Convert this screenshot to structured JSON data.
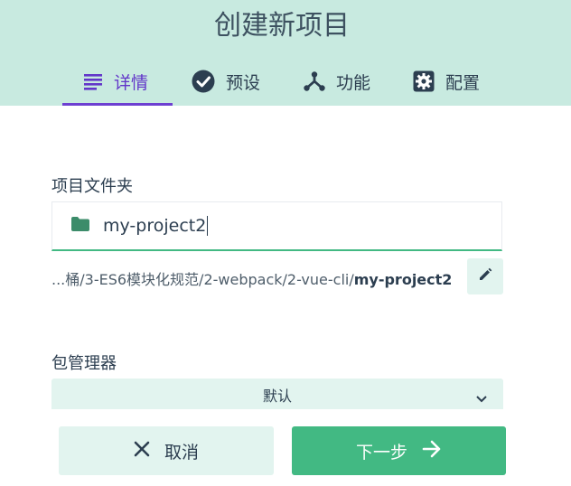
{
  "window": {
    "title": "创建新项目"
  },
  "tabs": [
    {
      "label": "详情",
      "icon": "list-icon",
      "active": true
    },
    {
      "label": "预设",
      "icon": "check-circle-icon",
      "active": false
    },
    {
      "label": "功能",
      "icon": "fork-icon",
      "active": false
    },
    {
      "label": "配置",
      "icon": "gear-box-icon",
      "active": false
    }
  ],
  "folder": {
    "label": "项目文件夹",
    "value": "my-project2",
    "icon": "folder-icon",
    "path_prefix": "...桶/3-ES6模块化规范/2-webpack/2-vue-cli/",
    "path_name": "my-project2",
    "edit_icon": "pencil-icon"
  },
  "package_manager": {
    "label": "包管理器",
    "selected": "默认",
    "icon": "chevron-down-icon"
  },
  "footer": {
    "cancel_label": "取消",
    "cancel_icon": "close-icon",
    "next_label": "下一步",
    "next_icon": "arrow-right-icon"
  },
  "colors": {
    "header_bg": "#c8eae0",
    "accent": "#42b983",
    "active_tab": "#6236c9",
    "light_button": "#e2f4ef",
    "text": "#2c3e50"
  }
}
